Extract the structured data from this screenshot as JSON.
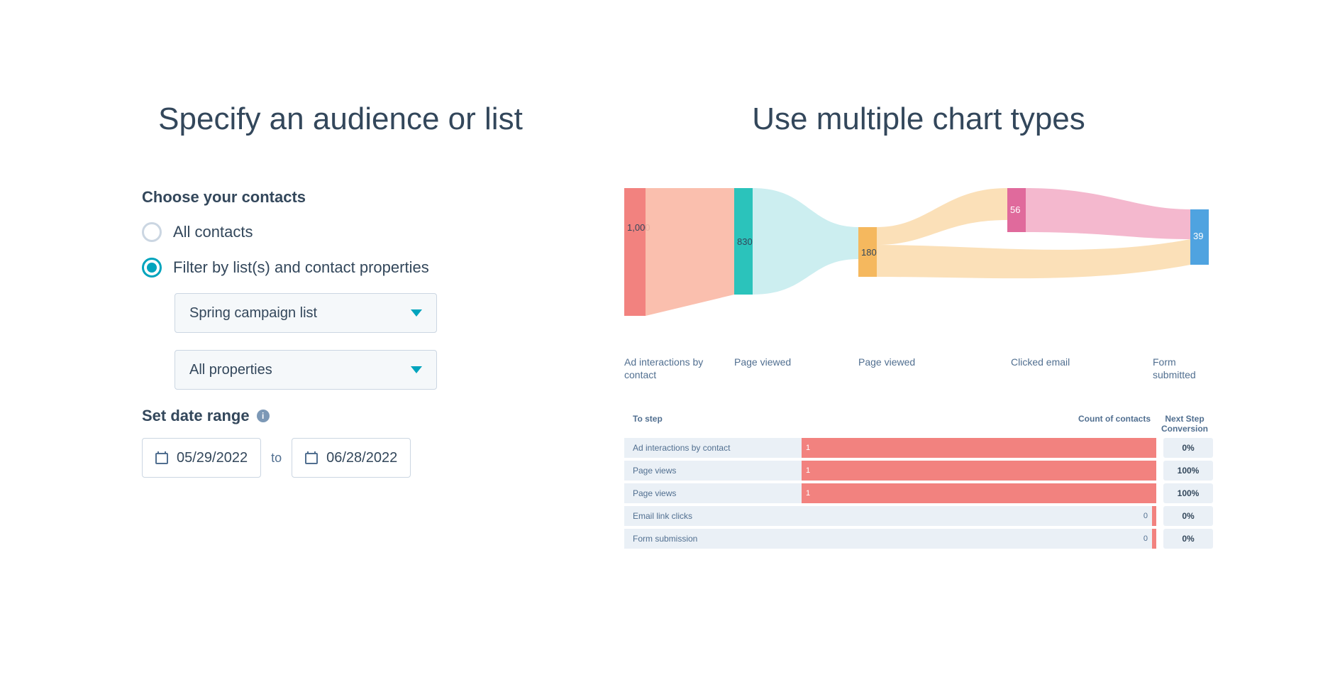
{
  "left": {
    "title": "Specify an audience or list",
    "contacts_label": "Choose your contacts",
    "radio_all": "All contacts",
    "radio_filter": "Filter by list(s) and contact properties",
    "select_list": "Spring campaign list",
    "select_properties": "All properties",
    "date_label": "Set date range",
    "date_from": "05/29/2022",
    "date_to_sep": "to",
    "date_to": "06/28/2022"
  },
  "right": {
    "title": "Use multiple chart types",
    "sankey": {
      "nodes": [
        {
          "label": "Ad interactions by contact",
          "value": "1,000"
        },
        {
          "label": "Page viewed",
          "value": "830"
        },
        {
          "label": "Page viewed",
          "value": "180"
        },
        {
          "label": "Clicked email",
          "value": "56"
        },
        {
          "label": "Form submitted",
          "value": "39"
        }
      ]
    },
    "table": {
      "th_step": "To step",
      "th_count": "Count of contacts",
      "th_conv": "Next Step Conversion",
      "rows": [
        {
          "step": "Ad interactions by contact",
          "count": "1",
          "fill": 100,
          "conv": "0%"
        },
        {
          "step": "Page views",
          "count": "1",
          "fill": 100,
          "conv": "100%"
        },
        {
          "step": "Page views",
          "count": "1",
          "fill": 100,
          "conv": "100%"
        },
        {
          "step": "Email link clicks",
          "count": "0",
          "fill": 0,
          "conv": "0%"
        },
        {
          "step": "Form submission",
          "count": "0",
          "fill": 0,
          "conv": "0%"
        }
      ]
    }
  },
  "chart_data": {
    "type": "sankey",
    "title": "Use multiple chart types",
    "nodes": [
      {
        "id": 0,
        "label": "Ad interactions by contact",
        "value": 1000
      },
      {
        "id": 1,
        "label": "Page viewed",
        "value": 830
      },
      {
        "id": 2,
        "label": "Page viewed",
        "value": 180
      },
      {
        "id": 3,
        "label": "Clicked email",
        "value": 56
      },
      {
        "id": 4,
        "label": "Form submitted",
        "value": 39
      }
    ],
    "links": [
      {
        "source": 0,
        "target": 1,
        "value": 830
      },
      {
        "source": 1,
        "target": 2,
        "value": 180
      },
      {
        "source": 2,
        "target": 3,
        "value": 56
      },
      {
        "source": 2,
        "target": 4,
        "value": 39
      },
      {
        "source": 3,
        "target": 4,
        "value": 39
      }
    ],
    "table": {
      "columns": [
        "To step",
        "Count of contacts",
        "Next Step Conversion"
      ],
      "rows": [
        [
          "Ad interactions by contact",
          1,
          "0%"
        ],
        [
          "Page views",
          1,
          "100%"
        ],
        [
          "Page views",
          1,
          "100%"
        ],
        [
          "Email link clicks",
          0,
          "0%"
        ],
        [
          "Form submission",
          0,
          "0%"
        ]
      ]
    }
  }
}
